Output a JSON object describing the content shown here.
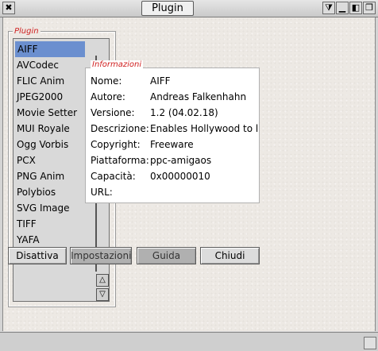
{
  "window": {
    "title": "Plugin",
    "close_glyph": "✖",
    "depth_glyph": "⧩",
    "iconify_glyph": "▁",
    "zoom_glyph": "◧",
    "front_glyph": "❐"
  },
  "plugin_group": {
    "label": "Plugin",
    "items": [
      "AIFF",
      "AVCodec",
      "FLIC Anim",
      "JPEG2000",
      "Movie Setter",
      "MUI Royale",
      "Ogg Vorbis",
      "PCX",
      "PNG Anim",
      "Polybios",
      "SVG Image",
      "TIFF",
      "YAFA"
    ],
    "selected": "AIFF",
    "scroll_up_glyph": "△",
    "scroll_down_glyph": "▽"
  },
  "info": {
    "label": "Informazioni",
    "rows": [
      {
        "label": "Nome:",
        "value": "AIFF"
      },
      {
        "label": "Autore:",
        "value": "Andreas Falkenhahn"
      },
      {
        "label": "Versione:",
        "value": "1.2 (04.02.18)"
      },
      {
        "label": "Descrizione:",
        "value": "Enables Hollywood to l"
      },
      {
        "label": "Copyright:",
        "value": "Freeware"
      },
      {
        "label": "Piattaforma:",
        "value": "ppc-amigaos"
      },
      {
        "label": "Capacità:",
        "value": "0x00000010"
      },
      {
        "label": "URL:",
        "value": ""
      }
    ]
  },
  "buttons": {
    "disable": "Disattiva",
    "settings": "Impostazioni",
    "help": "Guida",
    "close": "Chiudi"
  }
}
